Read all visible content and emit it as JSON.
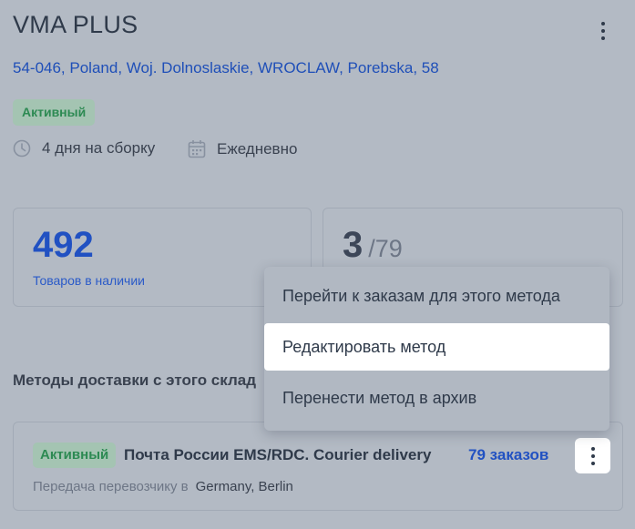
{
  "warehouse": {
    "name": "VMA PLUS",
    "address": "54-046, Poland, Woj. Dolnoslaskie, WROCLAW, Porebska, 58",
    "status": "Активный",
    "assembly_time": "4 дня на сборку",
    "schedule": "Ежедневно"
  },
  "stats": {
    "items_in_stock": "492",
    "items_in_stock_label": "Товаров в наличии",
    "methods_count": "3",
    "methods_total": "/79"
  },
  "methods_section": {
    "title": "Методы доставки с этого склад"
  },
  "method": {
    "status": "Активный",
    "name": "Почта России EMS/RDC. Courier delivery",
    "orders": "79 заказов",
    "transfer_label": "Передача перевозчику в",
    "transfer_location": "Germany, Berlin"
  },
  "context_menu": {
    "items": [
      "Перейти к заказам для этого метода",
      "Редактировать метод",
      "Перенести метод в архив"
    ]
  },
  "icons": {
    "clock": "clock-icon",
    "calendar": "calendar-icon",
    "more": "more-vertical-icon"
  },
  "colors": {
    "accent": "#2151c2",
    "status_bg": "#a4c4b2",
    "status_text": "#2d8a53"
  }
}
